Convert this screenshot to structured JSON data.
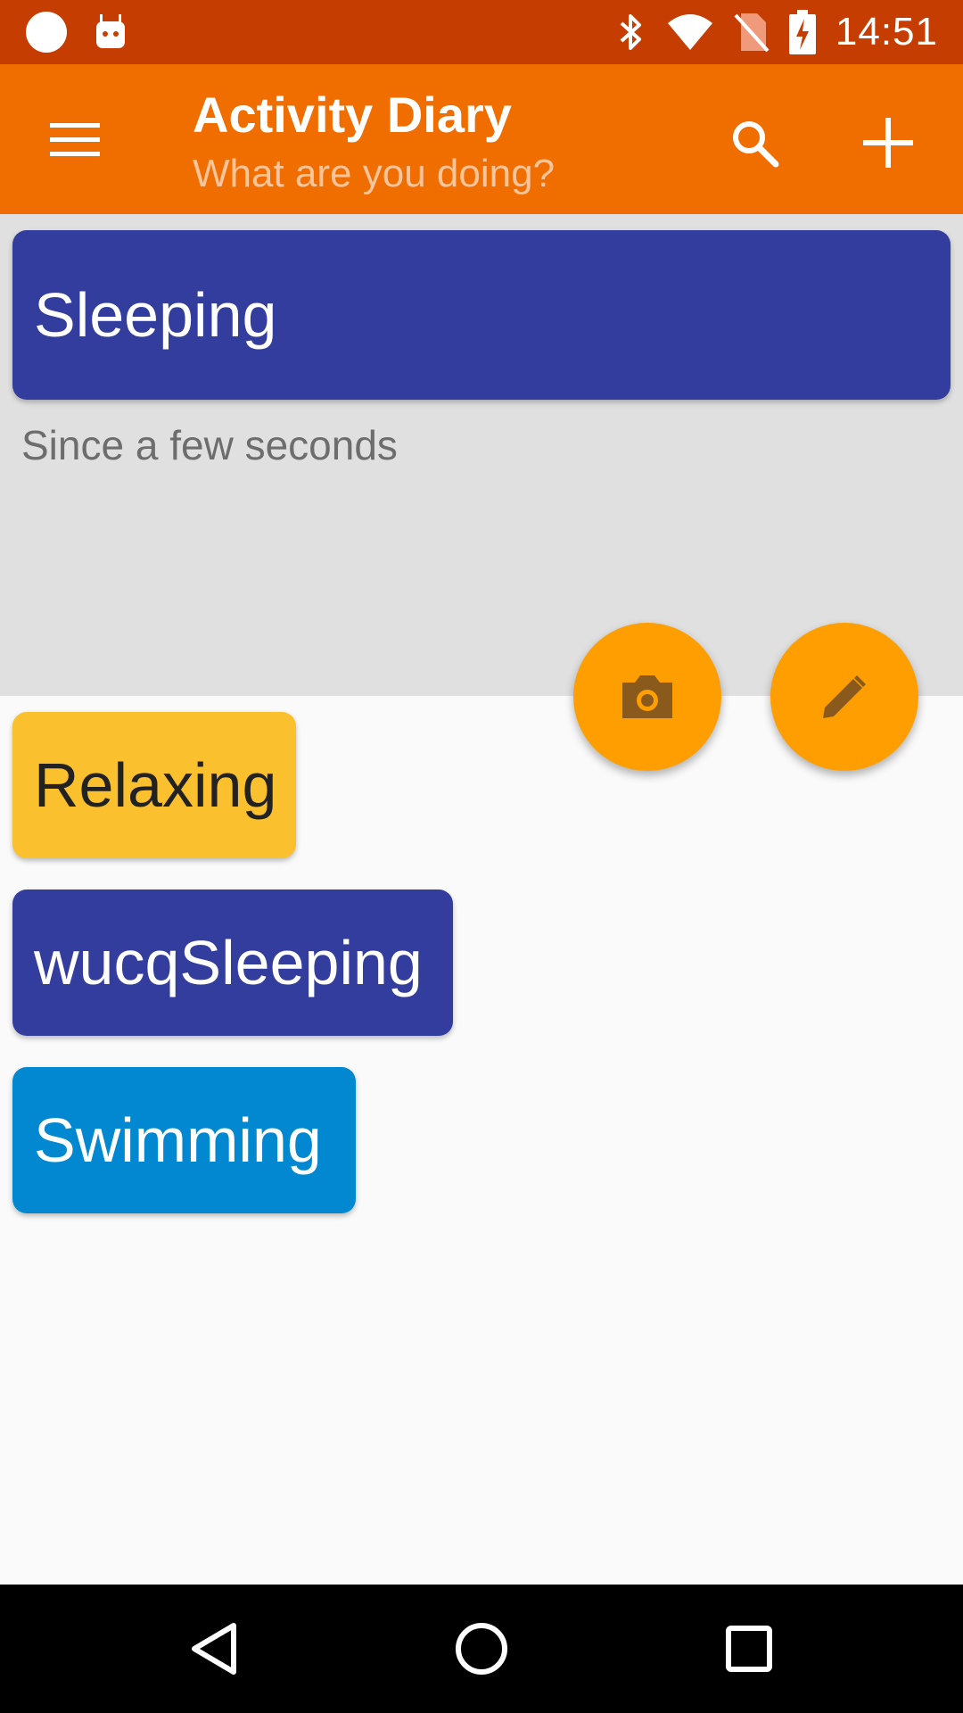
{
  "status_bar": {
    "time": "14:51",
    "icons": [
      "circle-notification-icon",
      "android-icon",
      "bluetooth-icon",
      "wifi-icon",
      "no-sim-icon",
      "battery-charging-icon"
    ]
  },
  "app_bar": {
    "title": "Activity Diary",
    "subtitle": "What are you doing?",
    "icons": [
      "menu-icon",
      "search-icon",
      "add-icon"
    ],
    "color": "#f06d00"
  },
  "current_activity": {
    "label": "Sleeping",
    "since": "Since a few seconds",
    "color": "#333d9e"
  },
  "fabs": [
    "camera-icon",
    "edit-icon"
  ],
  "activities": [
    {
      "label": "Relaxing",
      "color": "#fbc02d"
    },
    {
      "label": "wucqSleeping",
      "color": "#333d9e"
    },
    {
      "label": "Swimming",
      "color": "#0288d1"
    }
  ],
  "nav_bar": {
    "icons": [
      "back-icon",
      "home-icon",
      "recents-icon"
    ]
  }
}
